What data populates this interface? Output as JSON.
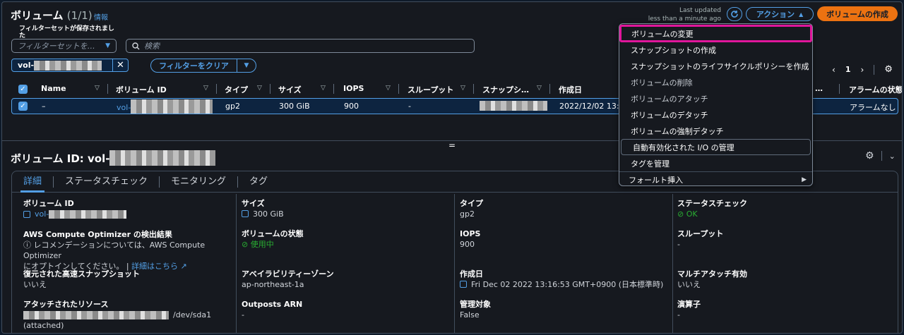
{
  "header": {
    "title": "ボリューム",
    "count": "(1/1)",
    "info": "情報",
    "last_updated_1": "Last updated",
    "last_updated_2": "less than a minute ago",
    "actions_label": "アクション",
    "create_label": "ボリュームの作成"
  },
  "filters": {
    "saved_label": "フィルターセットが保存されました",
    "saved_placeholder": "フィルターセットを…",
    "search_placeholder": "検索",
    "token_prefix": "vol-",
    "clear_label": "フィルターをクリア"
  },
  "pagination": {
    "page": "1"
  },
  "table": {
    "columns": [
      "Name",
      "ボリューム ID",
      "タイプ",
      "サイズ",
      "IOPS",
      "スループット",
      "スナップシ…",
      "作成日",
      "…",
      "アラームの状態"
    ],
    "row": {
      "name": "–",
      "volume_id_prefix": "vol-",
      "type": "gp2",
      "size": "300 GiB",
      "iops": "900",
      "throughput": "-",
      "created": "2022/12/02 13:1",
      "alarm": "アラームなし"
    }
  },
  "menu": {
    "items": [
      "ボリュームの変更",
      "スナップショットの作成",
      "スナップショットのライフサイクルポリシーを作成",
      "ボリュームの削除",
      "ボリュームのアタッチ",
      "ボリュームのデタッチ",
      "ボリュームの強制デタッチ",
      "自動有効化された I/O の管理",
      "タグを管理",
      "フォールト挿入"
    ]
  },
  "details": {
    "title_prefix": "ボリューム ID: vol-",
    "tabs": [
      "詳細",
      "ステータスチェック",
      "モニタリング",
      "タグ"
    ],
    "fields": {
      "volume_id_k": "ボリューム ID",
      "volume_id_v": "vol-",
      "optimizer_k": "AWS Compute Optimizer の検出結果",
      "optimizer_v1": "ⓘ レコメンデーションについては、AWS Compute Optimizer",
      "optimizer_v2": "にオプトインしてください。 |",
      "optimizer_link": "詳細はこちら",
      "restored_k": "復元された高速スナップショット",
      "restored_v": "いいえ",
      "attached_k": "アタッチされたリソース",
      "attached_v": "/dev/sda1",
      "attached_v2": "(attached)",
      "size_k": "サイズ",
      "size_v": "300 GiB",
      "state_k": "ボリュームの状態",
      "state_v": "使用中",
      "az_k": "アベイラビリティーゾーン",
      "az_v": "ap-northeast-1a",
      "outposts_k": "Outposts ARN",
      "outposts_v": "-",
      "type_k": "タイプ",
      "type_v": "gp2",
      "iops_k": "IOPS",
      "iops_v": "900",
      "created_k": "作成日",
      "created_v": "Fri Dec 02 2022 13:16:53 GMT+0900 (日本標準時)",
      "managed_k": "管理対象",
      "managed_v": "False",
      "status_k": "ステータスチェック",
      "status_v": "OK",
      "throughput_k": "スループット",
      "throughput_v": "-",
      "multi_k": "マルチアタッチ有効",
      "multi_v": "いいえ",
      "operator_k": "演算子",
      "operator_v": "-"
    }
  }
}
